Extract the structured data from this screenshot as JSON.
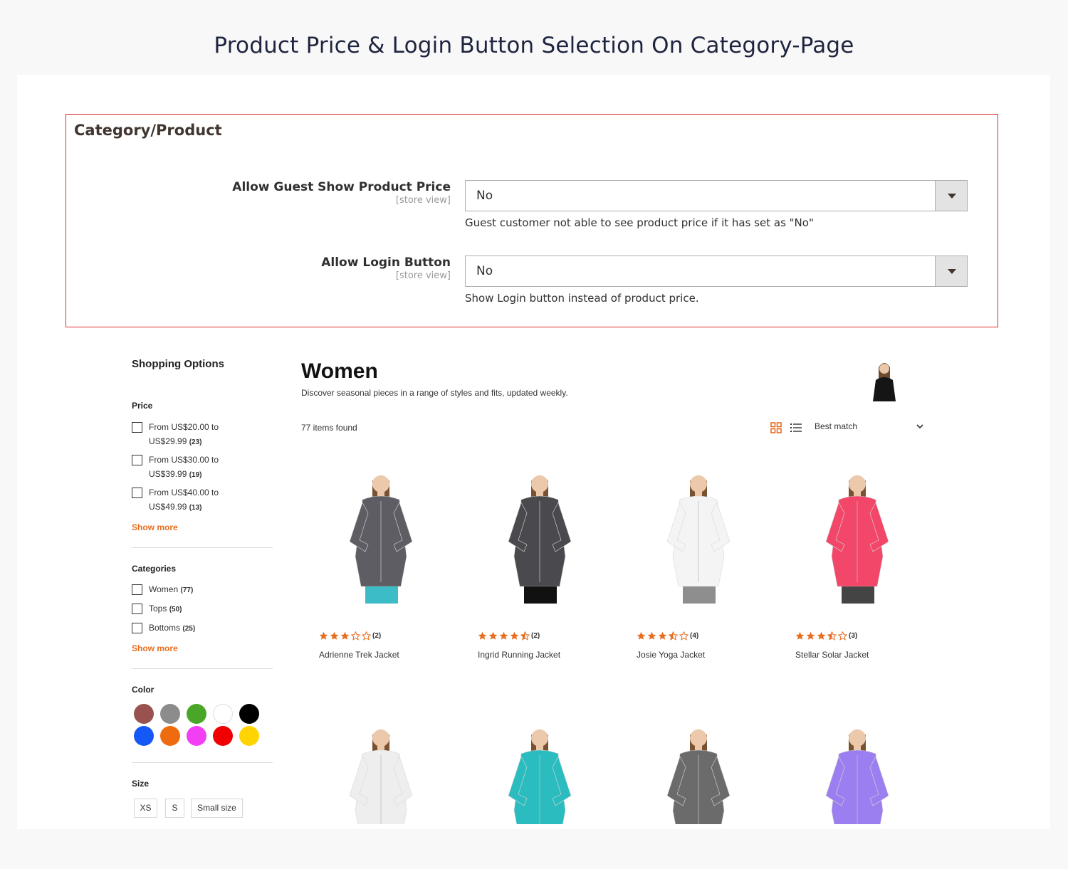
{
  "headline": "Product Price & Login Button Selection On Category-Page",
  "config": {
    "title": "Category/Product",
    "rows": [
      {
        "label": "Allow Guest Show Product Price",
        "scope": "[store view]",
        "value": "No",
        "note": "Guest customer not able to see product price if it has set as \"No\""
      },
      {
        "label": "Allow Login Button",
        "scope": "[store view]",
        "value": "No",
        "note": "Show Login button instead of product price."
      }
    ]
  },
  "sidebar": {
    "title": "Shopping Options",
    "price": {
      "title": "Price",
      "items": [
        {
          "line1": "From US$20.00 to",
          "line2": "US$29.99",
          "count": "(23)"
        },
        {
          "line1": "From US$30.00 to",
          "line2": "US$39.99",
          "count": "(19)"
        },
        {
          "line1": "From US$40.00 to",
          "line2": "US$49.99",
          "count": "(13)"
        }
      ],
      "show_more": "Show more"
    },
    "categories": {
      "title": "Categories",
      "items": [
        {
          "label": "Women",
          "count": "(77)"
        },
        {
          "label": "Tops",
          "count": "(50)"
        },
        {
          "label": "Bottoms",
          "count": "(25)"
        }
      ],
      "show_more": "Show more"
    },
    "color": {
      "title": "Color",
      "swatches": [
        "#9a5250",
        "#8c8c8c",
        "#4aa628",
        "#ffffff",
        "#000000",
        "#1558f5",
        "#ee6c0f",
        "#f33ff3",
        "#f00000",
        "#ffd400"
      ]
    },
    "size": {
      "title": "Size",
      "options": [
        "XS",
        "S",
        "Small size"
      ]
    }
  },
  "main": {
    "title": "Women",
    "description": "Discover seasonal pieces in a range of styles and fits, updated weekly.",
    "items_found": "77 items found",
    "sort_value": "Best match",
    "accent": "#e86d1f"
  },
  "products": [
    {
      "name": "Adrienne Trek Jacket",
      "rating": 3,
      "count": "(2)",
      "jacket": "#5e5d63",
      "pants": "#3cbcc7"
    },
    {
      "name": "Ingrid Running Jacket",
      "rating": 4.5,
      "count": "(2)",
      "jacket": "#4a4a4e",
      "pants": "#111111"
    },
    {
      "name": "Josie Yoga Jacket",
      "rating": 3.5,
      "count": "(4)",
      "jacket": "#f4f4f4",
      "pants": "#8e8e8e"
    },
    {
      "name": "Stellar Solar Jacket",
      "rating": 3.5,
      "count": "(3)",
      "jacket": "#f3476a",
      "pants": "#444444"
    },
    {
      "name": "",
      "rating": 0,
      "count": "",
      "jacket": "#eeeeee",
      "pants": "#cccccc"
    },
    {
      "name": "",
      "rating": 0,
      "count": "",
      "jacket": "#2bbcbf",
      "pants": "#1aa4a8"
    },
    {
      "name": "",
      "rating": 0,
      "count": "",
      "jacket": "#6b6b6b",
      "pants": "#555555"
    },
    {
      "name": "",
      "rating": 0,
      "count": "",
      "jacket": "#9b7ff0",
      "pants": "#3b2fb0"
    }
  ]
}
